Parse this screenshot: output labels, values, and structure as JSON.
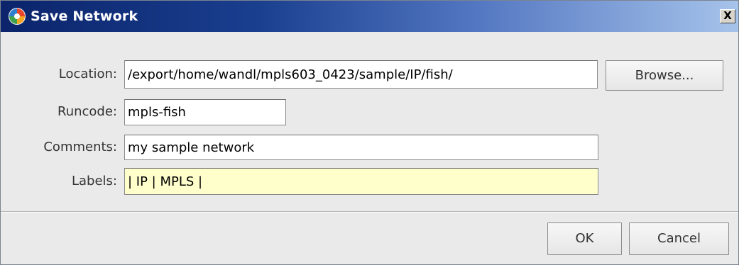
{
  "window": {
    "title": "Save Network",
    "close_label": "X",
    "icon": "app-logo-icon"
  },
  "form": {
    "location_label": "Location:",
    "location_value": "/export/home/wandl/mpls603_0423/sample/IP/fish/",
    "runcode_label": "Runcode:",
    "runcode_value": "mpls-fish",
    "comments_label": "Comments:",
    "comments_value": "my sample network",
    "labels_label": "Labels:",
    "labels_value": "| IP | MPLS |"
  },
  "buttons": {
    "browse_label": "Browse...",
    "ok_label": "OK",
    "cancel_label": "Cancel"
  },
  "colors": {
    "title_gradient_start": "#0b246b",
    "title_gradient_end": "#a6c3ea",
    "labels_field_bg": "#ffffcc",
    "dialog_bg": "#eaeaea"
  }
}
